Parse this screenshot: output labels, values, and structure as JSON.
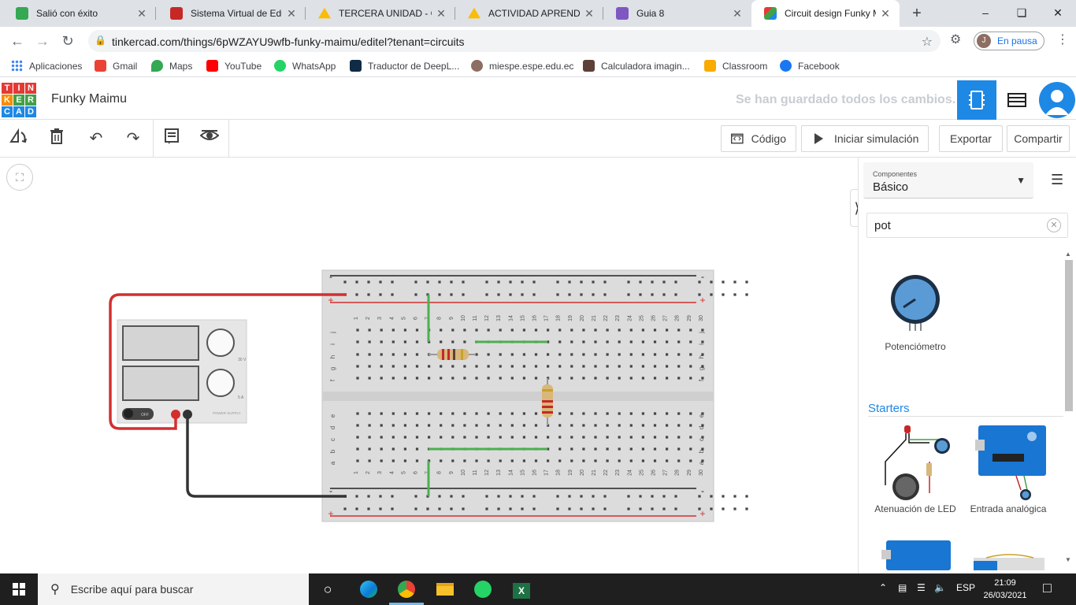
{
  "browser": {
    "tabs": [
      {
        "label": "Salió con éxito",
        "color": "#34a853"
      },
      {
        "label": "Sistema Virtual de Educ",
        "color": "#c62828"
      },
      {
        "label": "TERCERA UNIDAD - Go",
        "color": "#fbbc04"
      },
      {
        "label": "ACTIVIDAD APRENDIZA",
        "color": "#fbbc04"
      },
      {
        "label": "Guia 8",
        "color": "#7e57c2"
      },
      {
        "label": "Circuit design Funky Ma",
        "color": "#ef6c00"
      }
    ],
    "url": "tinkercad.com/things/6pWZAYU9wfb-funky-maimu/editel?tenant=circuits",
    "profile_initial": "J",
    "profile_status": "En pausa"
  },
  "bookmarks": [
    {
      "label": "Aplicaciones",
      "color": "#4285f4"
    },
    {
      "label": "Gmail",
      "color": "#ea4335"
    },
    {
      "label": "Maps",
      "color": "#34a853"
    },
    {
      "label": "YouTube",
      "color": "#ff0000"
    },
    {
      "label": "WhatsApp",
      "color": "#25d366"
    },
    {
      "label": "Traductor de DeepL...",
      "color": "#0f2b46"
    },
    {
      "label": "miespe.espe.edu.ec",
      "color": "#8d6e63"
    },
    {
      "label": "Calculadora imagin...",
      "color": "#5d4037"
    },
    {
      "label": "Classroom",
      "color": "#f9ab00"
    },
    {
      "label": "Facebook",
      "color": "#1877f2"
    }
  ],
  "tinkercad": {
    "logo_letters": [
      "T",
      "I",
      "N",
      "K",
      "E",
      "R",
      "C",
      "A",
      "D"
    ],
    "project_title": "Funky Maimu",
    "save_status": "Se han guardado todos los cambios.",
    "buttons": {
      "code": "Código",
      "simulate": "Iniciar simulación",
      "export": "Exportar",
      "share": "Compartir"
    }
  },
  "panel": {
    "components_label": "Componentes",
    "components_value": "Básico",
    "search_value": "pot",
    "result": "Potenciómetro",
    "starters_title": "Starters",
    "starters": [
      {
        "label": "Atenuación de LED"
      },
      {
        "label": "Entrada analógica"
      }
    ]
  },
  "breadboard": {
    "column_numbers": [
      "1",
      "2",
      "3",
      "4",
      "5",
      "6",
      "7",
      "8",
      "9",
      "10",
      "11",
      "12",
      "13",
      "14",
      "15",
      "16",
      "17",
      "18",
      "19",
      "20",
      "21",
      "22",
      "23",
      "24",
      "25",
      "26",
      "27",
      "28",
      "29",
      "30"
    ],
    "rows_top": [
      "j",
      "i",
      "h",
      "g",
      "f"
    ],
    "rows_bottom": [
      "e",
      "d",
      "c",
      "b",
      "a"
    ],
    "plus": "+",
    "minus": "-"
  },
  "power_supply": {
    "off_label": "OFF",
    "v_label": "30 V",
    "a_label": "5 A",
    "brand": "POWER SUPPLY"
  },
  "taskbar": {
    "search_placeholder": "Escribe aquí para buscar",
    "lang": "ESP",
    "time": "21:09",
    "date": "26/03/2021"
  },
  "colors": {
    "accent": "#1e88e5",
    "wire_red": "#d32f2f",
    "wire_black": "#333333",
    "wire_green": "#4caf50"
  }
}
